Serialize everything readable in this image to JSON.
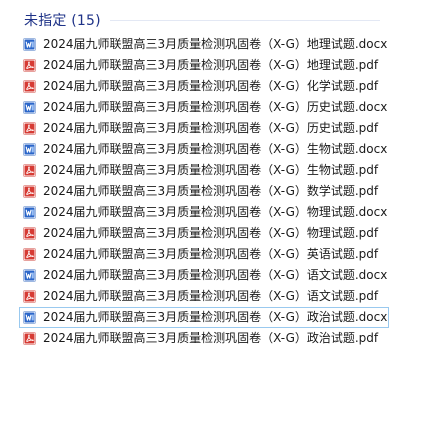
{
  "group": {
    "title": "未指定 (15)"
  },
  "files": [
    {
      "name": "2024届九师联盟高三3月质量检测巩固卷（X-G）地理试题.docx",
      "icon": "word-icon",
      "selected": false
    },
    {
      "name": "2024届九师联盟高三3月质量检测巩固卷（X-G）地理试题.pdf",
      "icon": "pdf-icon",
      "selected": false
    },
    {
      "name": "2024届九师联盟高三3月质量检测巩固卷（X-G）化学试题.pdf",
      "icon": "pdf-icon",
      "selected": false
    },
    {
      "name": "2024届九师联盟高三3月质量检测巩固卷（X-G）历史试题.docx",
      "icon": "word-icon",
      "selected": false
    },
    {
      "name": "2024届九师联盟高三3月质量检测巩固卷（X-G）历史试题.pdf",
      "icon": "pdf-icon",
      "selected": false
    },
    {
      "name": "2024届九师联盟高三3月质量检测巩固卷（X-G）生物试题.docx",
      "icon": "word-icon",
      "selected": false
    },
    {
      "name": "2024届九师联盟高三3月质量检测巩固卷（X-G）生物试题.pdf",
      "icon": "pdf-icon",
      "selected": false
    },
    {
      "name": "2024届九师联盟高三3月质量检测巩固卷（X-G）数学试题.pdf",
      "icon": "pdf-icon",
      "selected": false
    },
    {
      "name": "2024届九师联盟高三3月质量检测巩固卷（X-G）物理试题.docx",
      "icon": "word-icon",
      "selected": false
    },
    {
      "name": "2024届九师联盟高三3月质量检测巩固卷（X-G）物理试题.pdf",
      "icon": "pdf-icon",
      "selected": false
    },
    {
      "name": "2024届九师联盟高三3月质量检测巩固卷（X-G）英语试题.pdf",
      "icon": "pdf-icon",
      "selected": false
    },
    {
      "name": "2024届九师联盟高三3月质量检测巩固卷（X-G）语文试题.docx",
      "icon": "word-icon",
      "selected": false
    },
    {
      "name": "2024届九师联盟高三3月质量检测巩固卷（X-G）语文试题.pdf",
      "icon": "pdf-icon",
      "selected": false
    },
    {
      "name": "2024届九师联盟高三3月质量检测巩固卷（X-G）政治试题.docx",
      "icon": "word-icon",
      "selected": true
    },
    {
      "name": "2024届九师联盟高三3月质量检测巩固卷（X-G）政治试题.pdf",
      "icon": "pdf-icon",
      "selected": false
    }
  ],
  "colors": {
    "group_title": "#1e3287",
    "word_icon": "#2b66c9",
    "pdf_icon": "#d63b34",
    "selection_border": "#99c9ef"
  }
}
